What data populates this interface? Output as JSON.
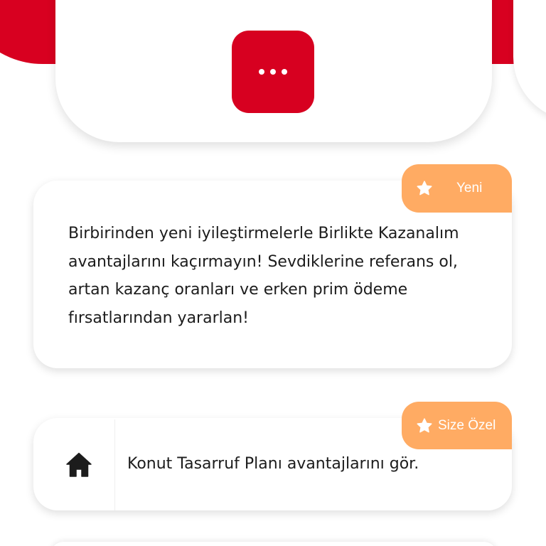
{
  "header": {
    "more_label": "More options"
  },
  "cards": [
    {
      "badge": "Yeni",
      "text": "Birbirinden yeni iyileştirmelerle Birlikte Kazanalım avantajlarını kaçırmayın! Sevdiklerine referans ol, artan kazanç oranları ve erken prim ödeme fırsatlarından yararlan!"
    },
    {
      "badge": "Size Özel",
      "icon": "home-icon",
      "text": "Konut Tasarruf Planı avantajlarını gör."
    }
  ],
  "colors": {
    "brand_red": "#d70020",
    "badge_orange": "#ffab63",
    "text_dark": "#1c1c1c"
  }
}
